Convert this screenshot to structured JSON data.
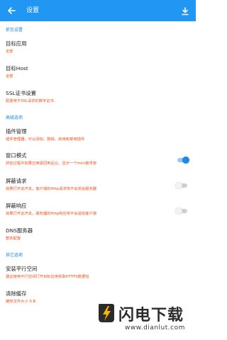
{
  "colors": {
    "accent": "#2196f3",
    "subtitle": "#f4511e",
    "section": "#1e88e5"
  },
  "appbar": {
    "title": "设置",
    "back_icon": "arrow-back-icon",
    "download_icon": "download-icon"
  },
  "sections": [
    {
      "header": "抓包设置",
      "items": [
        {
          "title": "目标应用",
          "subtitle": "全部"
        },
        {
          "title": "目标Host",
          "subtitle": "全部"
        },
        {
          "title": "SSL证书设置",
          "subtitle": "配置用于SSL请求的数字证书"
        }
      ]
    },
    {
      "header": "高级选项",
      "items": [
        {
          "title": "插件管理",
          "subtitle": "插件管理器。可以添加、删除、启用和禁用插件"
        },
        {
          "title": "窗口模式",
          "subtitle": "抓包过程中如果应用退回到后台，显示一个mini悬浮窗",
          "toggle": true
        },
        {
          "title": "屏蔽请求",
          "subtitle": "如果打开此开关，客户端的Http请求将不会发给服务器",
          "toggle": false
        },
        {
          "title": "屏蔽响应",
          "subtitle": "如果打开此开关，服务器的Http响应将不会返给客户端",
          "toggle": false
        },
        {
          "title": "DNS服务器",
          "subtitle": "暂未配置"
        }
      ]
    },
    {
      "header": "其它选项",
      "items": [
        {
          "title": "安装平行空间",
          "subtitle": "建议使用平行空间打开目标应用抓取HTTPS数据包"
        },
        {
          "title": "清除缓存",
          "subtitle": "缓存文件大小 0 B"
        }
      ]
    }
  ],
  "watermark": {
    "brand": "闪电下载",
    "url": "www.dianlut.com"
  }
}
